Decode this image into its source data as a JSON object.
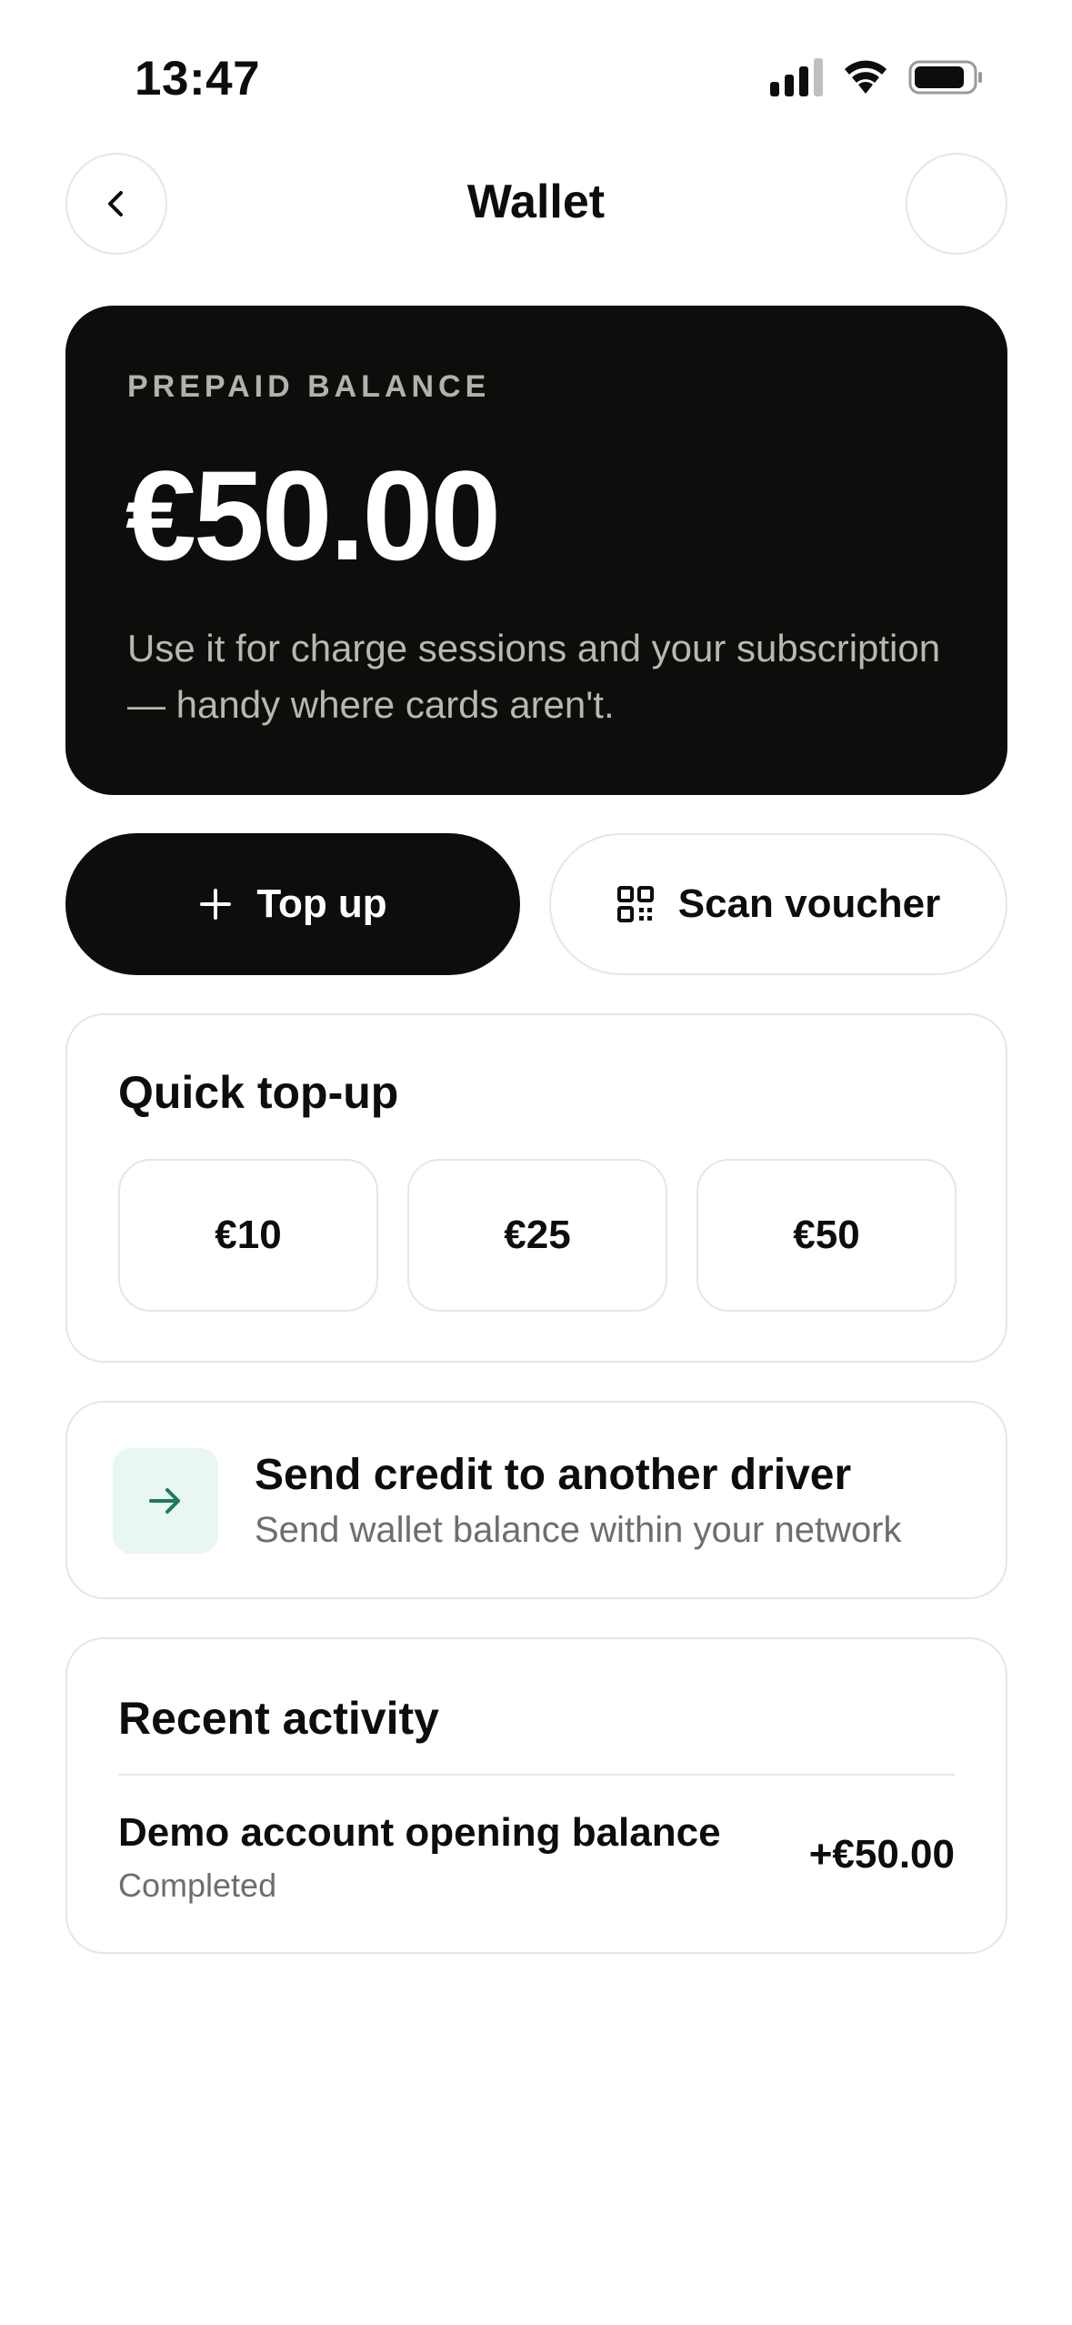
{
  "status_bar": {
    "time": "13:47",
    "icons": [
      "cellular-signal-icon",
      "wifi-icon",
      "battery-icon"
    ]
  },
  "nav": {
    "title": "Wallet",
    "back_icon": "chevron-left-icon"
  },
  "balance_card": {
    "label": "PREPAID BALANCE",
    "amount": "€50.00",
    "description": "Use it for charge sessions and your subscription — handy where cards aren't."
  },
  "actions": {
    "top_up_label": "Top up",
    "top_up_icon": "plus-icon",
    "scan_label": "Scan voucher",
    "scan_icon": "qr-code-icon"
  },
  "quick_topup": {
    "title": "Quick top-up",
    "amounts": [
      "€10",
      "€25",
      "€50"
    ]
  },
  "send_credit": {
    "title": "Send credit to another driver",
    "subtitle": "Send wallet balance within your network",
    "icon": "arrow-right-icon"
  },
  "recent_activity": {
    "title": "Recent activity",
    "transactions": [
      {
        "name": "Demo account opening balance",
        "status": "Completed",
        "amount": "+€50.00"
      }
    ]
  },
  "colors": {
    "primary_dark": "#0d0d0b",
    "accent_green": "#1f7a5a",
    "accent_green_bg": "#e8f7f0",
    "border": "#e6e6e4",
    "muted_text": "#6e6e6a"
  }
}
